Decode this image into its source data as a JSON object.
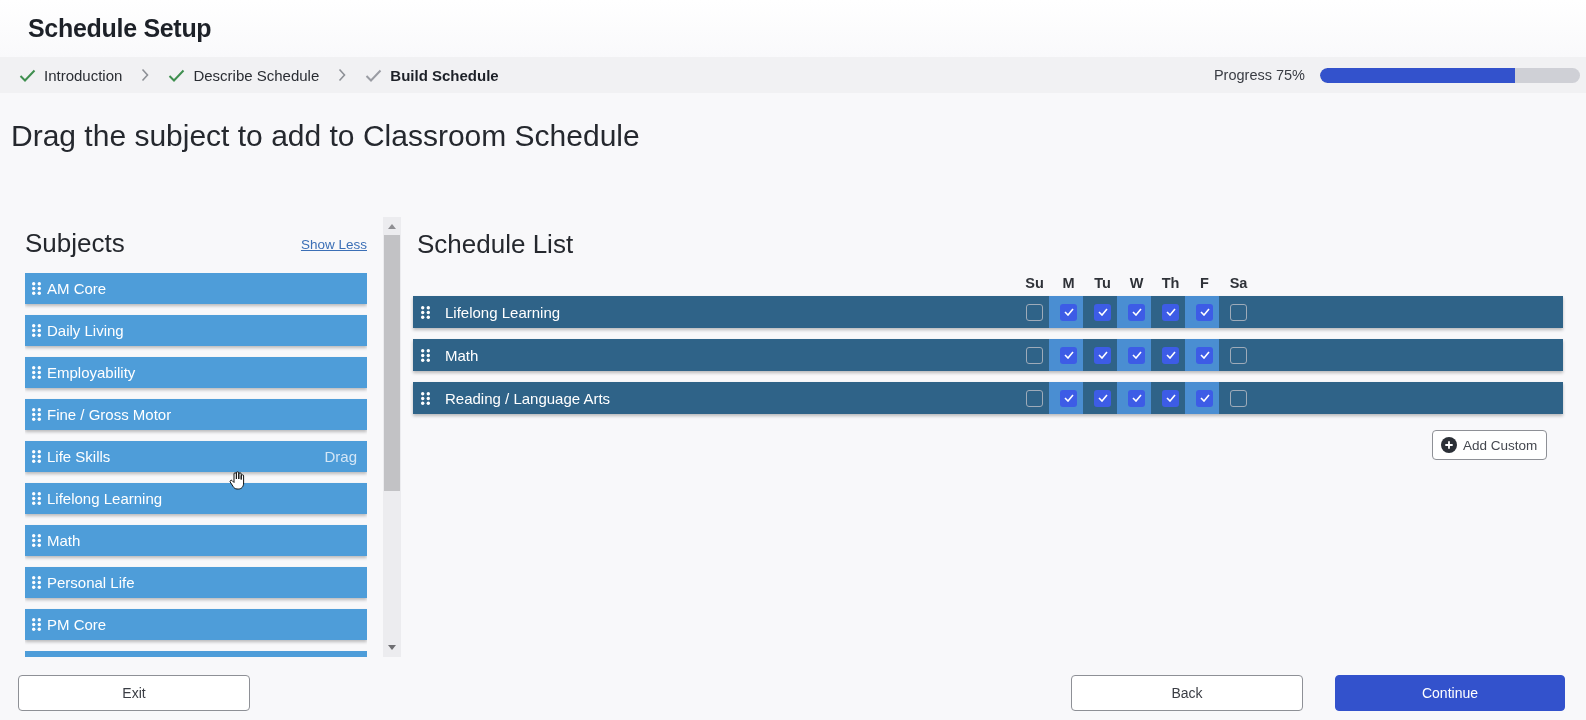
{
  "header": {
    "title": "Schedule Setup"
  },
  "steps": [
    {
      "label": "Introduction",
      "completed": true,
      "current": false
    },
    {
      "label": "Describe Schedule",
      "completed": true,
      "current": false
    },
    {
      "label": "Build Schedule",
      "completed": false,
      "current": true
    }
  ],
  "progress": {
    "label": "Progress 75%",
    "level": 0.75
  },
  "instruction": "Drag the subject to add to Classroom Schedule",
  "subjects": {
    "title": "Subjects",
    "toggle_link": "Show Less",
    "items": [
      {
        "label": "AM Core",
        "hovered": false
      },
      {
        "label": "Daily Living",
        "hovered": false
      },
      {
        "label": "Employability",
        "hovered": false
      },
      {
        "label": "Fine / Gross Motor",
        "hovered": false
      },
      {
        "label": "Life Skills",
        "hovered": true,
        "hint": "Drag"
      },
      {
        "label": "Lifelong Learning",
        "hovered": false
      },
      {
        "label": "Math",
        "hovered": false
      },
      {
        "label": "Personal Life",
        "hovered": false
      },
      {
        "label": "PM Core",
        "hovered": false
      }
    ],
    "more_below": true
  },
  "schedule": {
    "title": "Schedule List",
    "day_headers": [
      "Su",
      "M",
      "Tu",
      "W",
      "Th",
      "F",
      "Sa"
    ],
    "rows": [
      {
        "name": "Lifelong Learning",
        "days": [
          {
            "checked": false
          },
          {
            "checked": true
          },
          {
            "checked": true
          },
          {
            "checked": true
          },
          {
            "checked": true
          },
          {
            "checked": true
          },
          {
            "checked": false
          }
        ]
      },
      {
        "name": "Math",
        "days": [
          {
            "checked": false
          },
          {
            "checked": true
          },
          {
            "checked": true
          },
          {
            "checked": true
          },
          {
            "checked": true
          },
          {
            "checked": true
          },
          {
            "checked": false
          }
        ]
      },
      {
        "name": "Reading / Language Arts",
        "days": [
          {
            "checked": false
          },
          {
            "checked": true
          },
          {
            "checked": true
          },
          {
            "checked": true
          },
          {
            "checked": true
          },
          {
            "checked": true
          },
          {
            "checked": false
          }
        ]
      }
    ],
    "add_button": "Add Custom"
  },
  "footer": {
    "exit": "Exit",
    "back": "Back",
    "continue": "Continue"
  }
}
